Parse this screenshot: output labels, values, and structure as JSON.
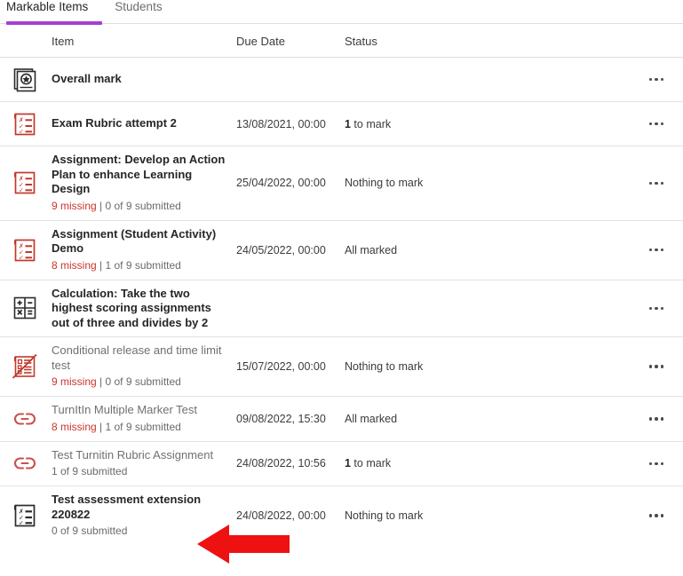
{
  "accent_color": "#a63ed4",
  "missing_color": "#c8372d",
  "annotation": {
    "type": "red-arrow",
    "direction": "left",
    "color": "#ee1111",
    "points_at": "Test assessment extension 220822"
  },
  "tabs": [
    {
      "label": "Markable Items",
      "active": true
    },
    {
      "label": "Students",
      "active": false
    }
  ],
  "table": {
    "columns": [
      "Item",
      "Due Date",
      "Status"
    ],
    "menu_icon": "kebab-menu-icon",
    "rows": [
      {
        "icon": "gradebook-star-icon",
        "title": "Overall mark",
        "sub_missing": "",
        "sub_rest": "",
        "due": "",
        "status_count": "",
        "status": "",
        "muted": false
      },
      {
        "icon": "rubric-checklist-icon",
        "title": "Exam Rubric attempt 2",
        "sub_missing": "",
        "sub_rest": "",
        "due": "13/08/2021, 00:00",
        "status_count": "1",
        "status": " to mark",
        "muted": false
      },
      {
        "icon": "rubric-checklist-icon",
        "title": "Assignment: Develop an Action Plan to enhance Learning Design",
        "sub_missing": "9 missing",
        "sub_rest": " | 0 of 9 submitted",
        "due": "25/04/2022, 00:00",
        "status_count": "",
        "status": "Nothing to mark",
        "muted": false
      },
      {
        "icon": "rubric-checklist-icon",
        "title": "Assignment (Student Activity) Demo",
        "sub_missing": "8 missing",
        "sub_rest": " | 1 of 9 submitted",
        "due": "24/05/2022, 00:00",
        "status_count": "",
        "status": "All marked",
        "muted": false
      },
      {
        "icon": "calculator-icon",
        "title": "Calculation: Take the two highest scoring assignments out of three and divides by 2",
        "sub_missing": "",
        "sub_rest": "",
        "due": "",
        "status_count": "",
        "status": "",
        "muted": false
      },
      {
        "icon": "test-restricted-icon",
        "title": "Conditional release and time limit test",
        "sub_missing": "9 missing",
        "sub_rest": " | 0 of 9 submitted",
        "due": "15/07/2022, 00:00",
        "status_count": "",
        "status": "Nothing to mark",
        "muted": true
      },
      {
        "icon": "link-chain-icon",
        "title": "TurnItIn Multiple Marker Test",
        "sub_missing": "8 missing",
        "sub_rest": " | 1 of 9 submitted",
        "due": "09/08/2022, 15:30",
        "status_count": "",
        "status": "All marked",
        "muted": true
      },
      {
        "icon": "link-chain-icon",
        "title": "Test Turnitin Rubric Assignment",
        "sub_missing": "",
        "sub_rest": "1 of 9 submitted",
        "due": "24/08/2022, 10:56",
        "status_count": "1",
        "status": " to mark",
        "muted": true
      },
      {
        "icon": "rubric-dark-icon",
        "title": "Test assessment extension 220822",
        "sub_missing": "",
        "sub_rest": "0 of 9 submitted",
        "due": "24/08/2022, 00:00",
        "status_count": "",
        "status": "Nothing to mark",
        "muted": false
      }
    ]
  }
}
